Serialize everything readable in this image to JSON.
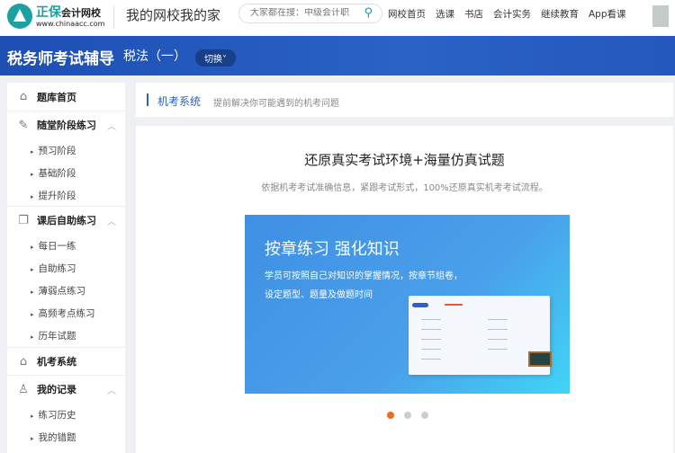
{
  "header": {
    "brand": "正保",
    "brand_sub": "会计网校",
    "url": "www.chinaacc.com",
    "slogan": "我的网校我的家",
    "search_placeholder": "大家都在搜：中级会计职",
    "nav": [
      "网校首页",
      "选课",
      "书店",
      "会计实务",
      "继续教育",
      "App看课"
    ]
  },
  "band": {
    "title": "税务师考试辅导",
    "subject": "税法（一）",
    "switch": "切换"
  },
  "sidebar": {
    "home": "题库首页",
    "s1": {
      "label": "随堂阶段练习",
      "items": [
        "预习阶段",
        "基础阶段",
        "提升阶段"
      ]
    },
    "s2": {
      "label": "课后自助练习",
      "items": [
        "每日一练",
        "自助练习",
        "薄弱点练习",
        "高频考点练习",
        "历年试题"
      ]
    },
    "exam": "机考系统",
    "s3": {
      "label": "我的记录",
      "items": [
        "练习历史",
        "我的错题"
      ]
    }
  },
  "main": {
    "title": "机考系统",
    "desc": "提前解决你可能遇到的机考问题",
    "headline": "还原真实考试环境+海量仿真试题",
    "subline": "依据机考考试准确信息，紧跟考试形式，100%还原真实机考考试流程。",
    "slide": {
      "title": "按章练习 强化知识",
      "text1": "学员可按照自己对知识的掌握情况，按章节组卷，",
      "text2": "设定题型、题量及做题时间"
    },
    "carousel": {
      "count": 3,
      "active": 0
    }
  }
}
